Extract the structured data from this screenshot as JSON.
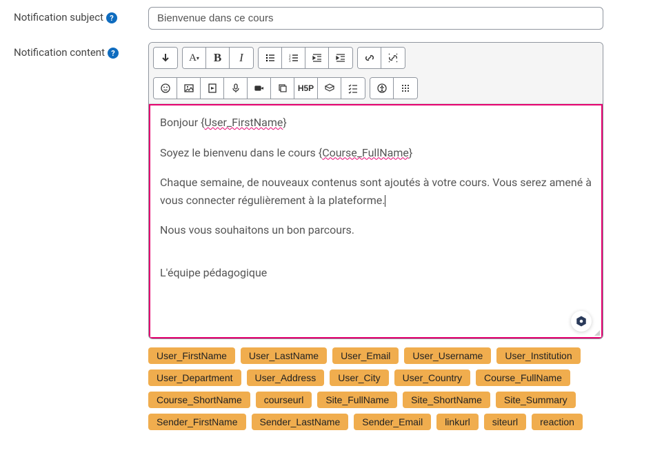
{
  "labels": {
    "subject": "Notification subject",
    "content": "Notification content"
  },
  "subject_value": "Bienvenue dans ce cours",
  "editor": {
    "line1_pre": "Bonjour {",
    "line1_var": "User_FirstName",
    "line1_post": "}",
    "line2_pre": "Soyez le bienvenu dans le cours {",
    "line2_var": "Course_FullName",
    "line2_post": "}",
    "line3": "Chaque semaine, de nouveaux contenus sont ajoutés à votre cours. Vous serez amené à vous connecter régulièrement à la plateforme.",
    "line4": "Nous vous souhaitons un bon parcours.",
    "line5": "L'équipe pédagogique"
  },
  "tags": [
    "User_FirstName",
    "User_LastName",
    "User_Email",
    "User_Username",
    "User_Institution",
    "User_Department",
    "User_Address",
    "User_City",
    "User_Country",
    "Course_FullName",
    "Course_ShortName",
    "courseurl",
    "Site_FullName",
    "Site_ShortName",
    "Site_Summary",
    "Sender_FirstName",
    "Sender_LastName",
    "Sender_Email",
    "linkurl",
    "siteurl",
    "reaction"
  ]
}
